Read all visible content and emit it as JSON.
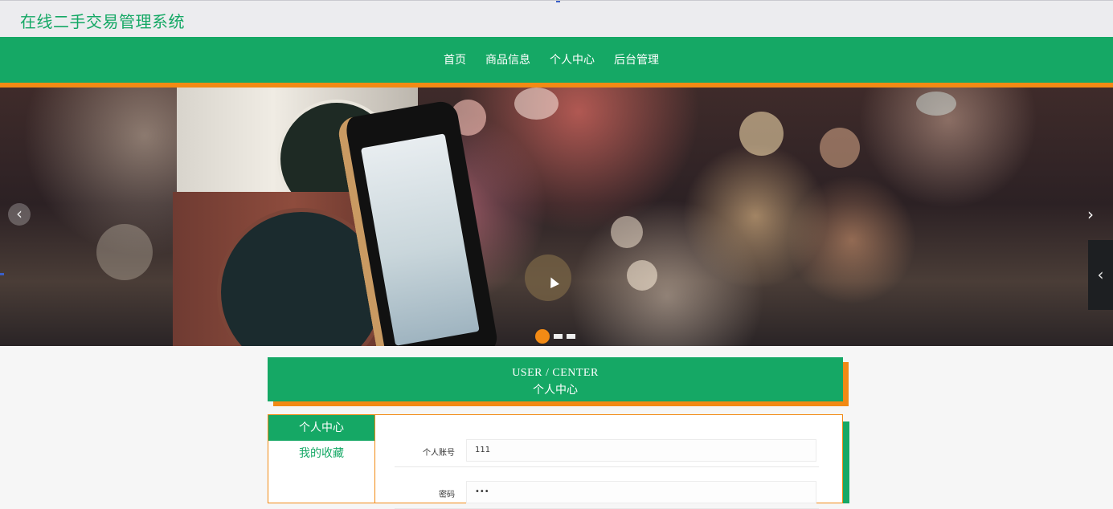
{
  "header": {
    "site_title": "在线二手交易管理系统"
  },
  "nav": {
    "items": [
      {
        "label": "首页"
      },
      {
        "label": "商品信息"
      },
      {
        "label": "个人中心"
      },
      {
        "label": "后台管理"
      }
    ]
  },
  "carousel": {
    "prev_icon": "‹",
    "next_icon": "›",
    "side_tab_icon": "‹",
    "slides_total": 3,
    "active_slide": 1
  },
  "section": {
    "title_en": "USER / CENTER",
    "title_cn": "个人中心"
  },
  "sidebar_menu": {
    "items": [
      {
        "label": "个人中心",
        "active": true
      },
      {
        "label": "我的收藏",
        "active": false
      }
    ]
  },
  "form": {
    "fields": [
      {
        "label": "个人账号",
        "value": "111"
      },
      {
        "label": "密码",
        "value": "•••"
      }
    ]
  },
  "colors": {
    "brand_green": "#15a865",
    "accent_orange": "#f28a14"
  }
}
